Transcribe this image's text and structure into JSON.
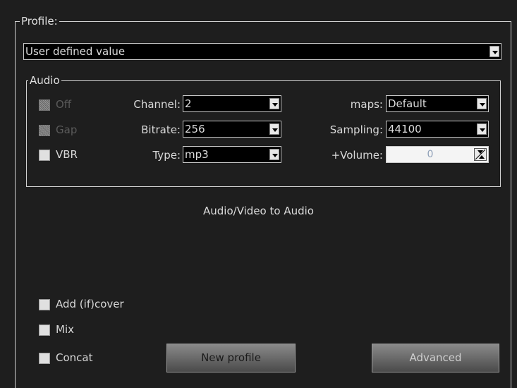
{
  "profile": {
    "group_title": "Profile:",
    "selected": "User defined value"
  },
  "audio": {
    "group_title": "Audio",
    "off_label": "Off",
    "gap_label": "Gap",
    "vbr_label": "VBR",
    "channel_label": "Channel:",
    "channel_value": "2",
    "bitrate_label": "Bitrate:",
    "bitrate_value": "256",
    "type_label": "Type:",
    "type_value": "mp3",
    "maps_label": "maps:",
    "maps_value": "Default",
    "sampling_label": "Sampling:",
    "sampling_value": "44100",
    "volume_label": "+Volume:",
    "volume_value": "0"
  },
  "description": "Audio/Video to Audio",
  "options": {
    "add_cover_label": "Add (if)cover",
    "mix_label": "Mix",
    "concat_label": "Concat"
  },
  "buttons": {
    "new_profile": "New profile",
    "advanced": "Advanced"
  }
}
